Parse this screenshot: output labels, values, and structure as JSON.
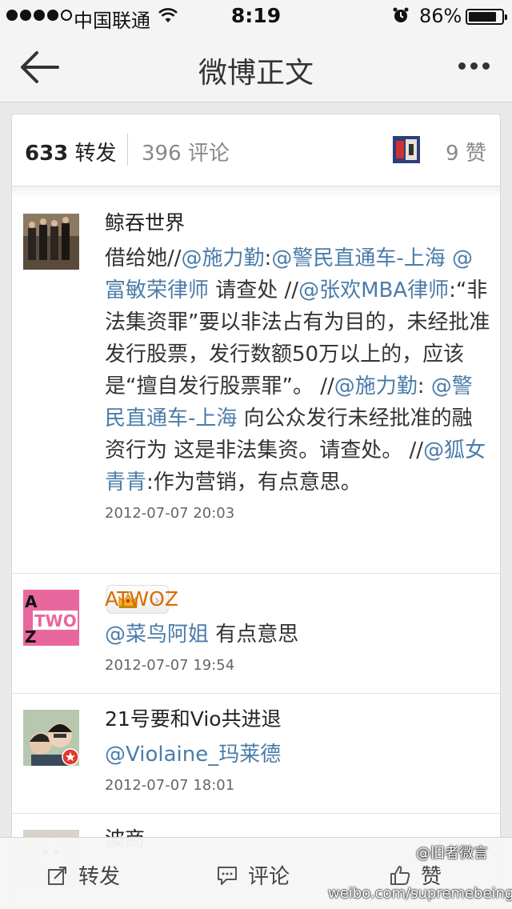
{
  "status_bar": {
    "carrier": "中国联通",
    "time": "8:19",
    "battery": "86%",
    "battery_level": 0.86
  },
  "nav": {
    "title": "微博正文",
    "back_icon": "back-arrow-icon",
    "more_icon": "more-dots-icon"
  },
  "tabs": {
    "repost_count": "633",
    "repost_label": "转发",
    "comment_count": "396",
    "comment_label": "评论",
    "like_count": "9",
    "like_label": "赞"
  },
  "reposts": [
    {
      "user": "鲸吞世界",
      "segments": [
        {
          "t": "借给她//",
          "m": false
        },
        {
          "t": "@施力勤",
          "m": true
        },
        {
          "t": ":",
          "m": false
        },
        {
          "t": "@警民直通车-上海",
          "m": true
        },
        {
          "t": " ",
          "m": false
        },
        {
          "t": "@富敏荣律师",
          "m": true
        },
        {
          "t": " 请查处 //",
          "m": false
        },
        {
          "t": "@张欢MBA律师",
          "m": true
        },
        {
          "t": ":“非法集资罪”要以非法占有为目的，未经批准发行股票，发行数额50万以上的，应该是“擅自发行股票罪”。 //",
          "m": false
        },
        {
          "t": "@施力勤",
          "m": true
        },
        {
          "t": ": ",
          "m": false
        },
        {
          "t": "@警民直通车-上海",
          "m": true
        },
        {
          "t": " 向公众发行未经批准的融资行为 这是非法集资。请查处。 //",
          "m": false
        },
        {
          "t": "@狐女青青",
          "m": true
        },
        {
          "t": ":作为营销，有点意思。",
          "m": false
        }
      ],
      "time": "2012-07-07 20:03"
    },
    {
      "user": "ATWOZ",
      "avatar_text": "TWO",
      "badge_icon": "crown-icon",
      "segments": [
        {
          "t": "@菜鸟阿姐",
          "m": true
        },
        {
          "t": " 有点意思",
          "m": false
        }
      ],
      "time": "2012-07-07 19:54"
    },
    {
      "user": "21号要和Vio共进退",
      "segments": [
        {
          "t": "@Violaine_玛莱德",
          "m": true
        }
      ],
      "time": "2012-07-07 18:01"
    },
    {
      "user": "波商",
      "segments": [],
      "time": ""
    }
  ],
  "toolbar": {
    "repost": "转发",
    "comment": "评论",
    "like": "赞"
  },
  "watermark": {
    "line1": "@旧者微言",
    "line2": "weibo.com/supremebeing"
  },
  "colors": {
    "mention": "#4a7ca8",
    "vip_name": "#d96b00",
    "background": "#e9e9e9"
  }
}
